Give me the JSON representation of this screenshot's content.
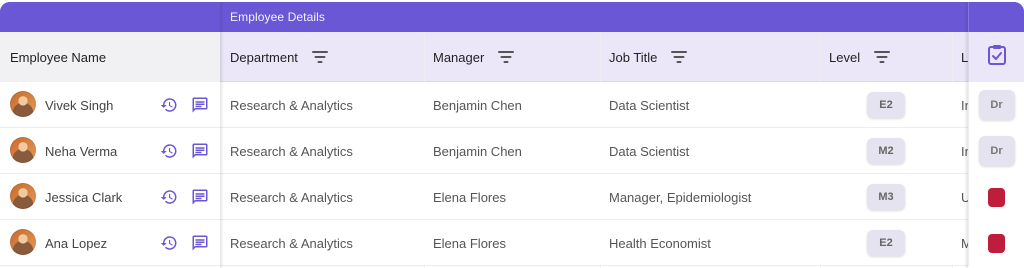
{
  "group_header": {
    "label": "Employee Details"
  },
  "columns": {
    "name": "Employee Name",
    "department": "Department",
    "manager": "Manager",
    "job_title": "Job Title",
    "level": "Level",
    "truncated": "L"
  },
  "rows": [
    {
      "name": "Vivek Singh",
      "department": "Research & Analytics",
      "manager": "Benjamin Chen",
      "job_title": "Data Scientist",
      "level": "E2",
      "truncated": "In",
      "pinned": "Dr",
      "pinned_type": "badge"
    },
    {
      "name": "Neha Verma",
      "department": "Research & Analytics",
      "manager": "Benjamin Chen",
      "job_title": "Data Scientist",
      "level": "M2",
      "truncated": "In",
      "pinned": "Dr",
      "pinned_type": "badge"
    },
    {
      "name": "Jessica Clark",
      "department": "Research & Analytics",
      "manager": "Elena Flores",
      "job_title": "Manager, Epidemiologist",
      "level": "M3",
      "truncated": "U",
      "pinned": "",
      "pinned_type": "red"
    },
    {
      "name": "Ana Lopez",
      "department": "Research & Analytics",
      "manager": "Elena Flores",
      "job_title": "Health Economist",
      "level": "E2",
      "truncated": "M",
      "pinned": "",
      "pinned_type": "red"
    }
  ],
  "colors": {
    "header_band": "#6a57d6",
    "header_row": "#ebe7f8",
    "icon": "#6a57d6",
    "status_red": "#be1e3c"
  },
  "icons": {
    "history": "history-icon",
    "comment": "comment-icon",
    "filter": "filter-icon",
    "checklist": "clipboard-check-icon"
  }
}
